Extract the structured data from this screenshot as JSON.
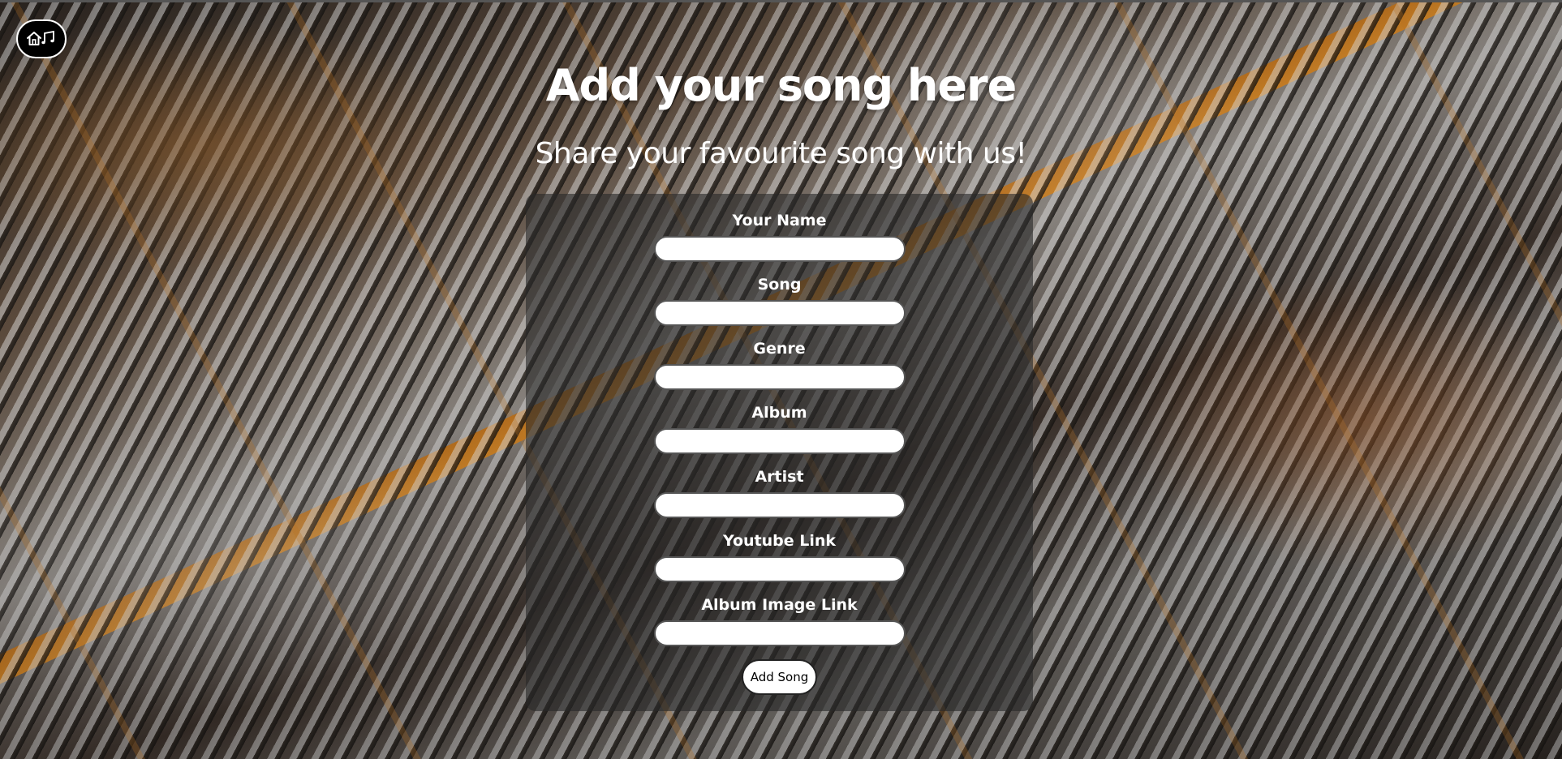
{
  "nav": {
    "home_icon": "home-music-icon"
  },
  "header": {
    "title": "Add your song here",
    "subtitle": "Share your favourite song with us!"
  },
  "form": {
    "fields": [
      {
        "label": "Your Name",
        "value": "",
        "placeholder": ""
      },
      {
        "label": "Song",
        "value": "",
        "placeholder": ""
      },
      {
        "label": "Genre",
        "value": "",
        "placeholder": ""
      },
      {
        "label": "Album",
        "value": "",
        "placeholder": ""
      },
      {
        "label": "Artist",
        "value": "",
        "placeholder": ""
      },
      {
        "label": "Youtube Link",
        "value": "",
        "placeholder": ""
      },
      {
        "label": "Album Image Link",
        "value": "",
        "placeholder": ""
      }
    ],
    "submit_label": "Add Song"
  },
  "colors": {
    "panel": "#282828",
    "text": "#ffffff",
    "button_bg": "#ffffff"
  }
}
